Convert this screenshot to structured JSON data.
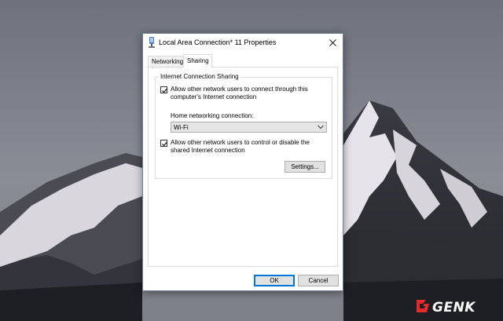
{
  "dialog": {
    "title": "Local Area Connection* 11 Properties",
    "title_icon": "network-adapter-icon",
    "close_icon": "close-icon"
  },
  "tabs": [
    {
      "label": "Networking",
      "selected": false
    },
    {
      "label": "Sharing",
      "selected": true
    }
  ],
  "sharing": {
    "group_title": "Internet Connection Sharing",
    "allow_connect": {
      "label": "Allow other network users to connect through this computer's Internet connection",
      "checked": true
    },
    "home_network_label": "Home networking connection:",
    "home_network_value": "Wi-Fi",
    "allow_control": {
      "label": "Allow other network users to control or disable the shared Internet connection",
      "checked": true
    },
    "settings_label": "Settings..."
  },
  "footer": {
    "ok_label": "OK",
    "cancel_label": "Cancel"
  },
  "watermark": {
    "logo_text": "GENK"
  },
  "colors": {
    "accent": "#0078d7",
    "button_face": "#e1e1e1",
    "watermark_red": "#e52b2b"
  }
}
